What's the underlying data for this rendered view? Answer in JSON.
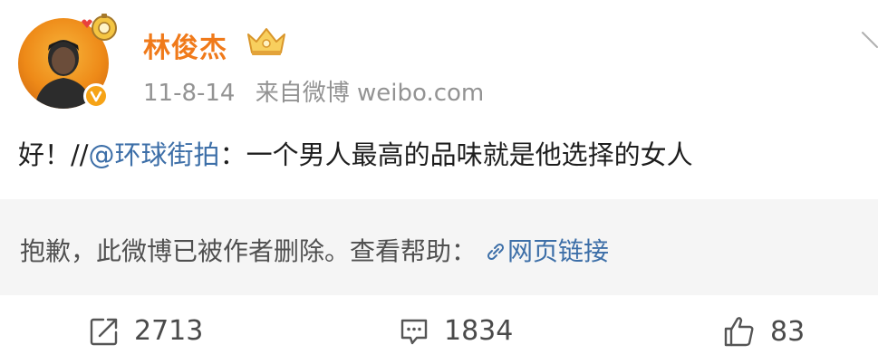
{
  "post": {
    "author": "林俊杰",
    "time": "11-8-14",
    "source": "来自微博 weibo.com",
    "content": {
      "prefix": "好！//",
      "mention": "@环球街拍",
      "suffix": "：一个男人最高的品味就是他选择的女人"
    },
    "deleted_notice": {
      "text": "抱歉，此微博已被作者删除。查看帮助：",
      "link_label": "网页链接"
    },
    "actions": {
      "repost_count": "2713",
      "comment_count": "1834",
      "like_count": "83"
    }
  },
  "colors": {
    "author_name": "#f07a1a",
    "link": "#3d6fa8",
    "meta": "#939393",
    "deleted_bg": "#f5f5f5"
  },
  "icons": {
    "avatar_badge": "verified-v-icon",
    "membership": "vip-crown-icon",
    "decoration": "avatar-pendant-icon",
    "more": "chevron-down-icon",
    "link": "link-icon",
    "repost": "repost-icon",
    "comment": "comment-icon",
    "like": "thumbs-up-icon"
  }
}
